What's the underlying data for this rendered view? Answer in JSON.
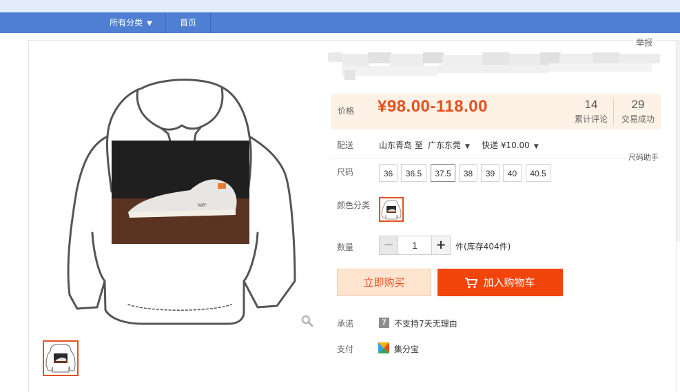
{
  "nav": {
    "category_label": "所有分类",
    "category_arrow": "▼",
    "home_label": "首页"
  },
  "report_label": "举报",
  "price": {
    "label": "价格",
    "value": "¥98.00-118.00",
    "reviews_count": "14",
    "reviews_label": "累计评论",
    "sales_count": "29",
    "sales_label": "交易成功"
  },
  "delivery": {
    "label": "配送",
    "from": "山东青岛 至",
    "to": "广东东莞",
    "method": "快递 ¥10.00"
  },
  "size_helper": "尺码助手",
  "size": {
    "label": "尺码",
    "options": [
      "36",
      "36.5",
      "37.5",
      "38",
      "39",
      "40",
      "40.5"
    ],
    "selected": "37.5"
  },
  "color": {
    "label": "颜色分类"
  },
  "quantity": {
    "label": "数量",
    "minus": "−",
    "value": "1",
    "plus": "+",
    "stock": "件(库存404件)"
  },
  "buttons": {
    "buy_now": "立即购买",
    "add_cart": "加入购物车"
  },
  "promise": {
    "label": "承诺",
    "icon_glyph": "7",
    "text": "不支持7天无理由"
  },
  "payment": {
    "label": "支付",
    "text": "集分宝"
  },
  "colors": {
    "accent": "#e4501e",
    "nav": "#4f7fd3",
    "add_cart_bg": "#f2450c",
    "price_bg": "#fef1e6"
  }
}
